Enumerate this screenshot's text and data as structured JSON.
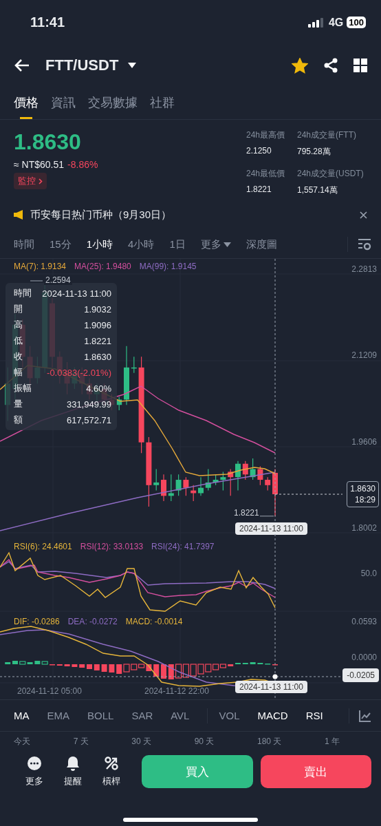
{
  "status_bar": {
    "time": "11:41",
    "network": "4G",
    "battery": "100"
  },
  "header": {
    "pair": "FTT/USDT",
    "favorite": true
  },
  "tabs": [
    {
      "label": "價格",
      "selected": true
    },
    {
      "label": "資訊",
      "selected": false
    },
    {
      "label": "交易數據",
      "selected": false
    },
    {
      "label": "社群",
      "selected": false
    }
  ],
  "ticker": {
    "price": "1.8630",
    "fiat": "≈ NT$60.51",
    "change": "-8.86%",
    "alert_button": "監控",
    "stats": [
      {
        "label": "24h最高價",
        "value": "2.1250"
      },
      {
        "label": "24h成交量(FTT)",
        "value": "795.28萬"
      },
      {
        "label": "24h最低價",
        "value": "1.8221"
      },
      {
        "label": "24h成交量(USDT)",
        "value": "1,557.14萬"
      }
    ]
  },
  "announcement": {
    "text": "币安每日热门币种（9月30日）"
  },
  "intervals": [
    {
      "label": "時間",
      "selected": false,
      "kind": "plain"
    },
    {
      "label": "15分",
      "selected": false,
      "kind": "plain"
    },
    {
      "label": "1小時",
      "selected": true,
      "kind": "plain"
    },
    {
      "label": "4小時",
      "selected": false,
      "kind": "plain"
    },
    {
      "label": "1日",
      "selected": false,
      "kind": "plain"
    },
    {
      "label": "更多",
      "selected": false,
      "kind": "dropdown"
    },
    {
      "label": "深度圖",
      "selected": false,
      "kind": "plain"
    }
  ],
  "chart": {
    "ma_legend": [
      {
        "label": "MA(7): 1.9134",
        "color": "#e6a93a"
      },
      {
        "label": "MA(25): 1.9480",
        "color": "#d44f9e"
      },
      {
        "label": "MA(99): 1.9145",
        "color": "#8e6cc4"
      }
    ],
    "price_axis": [
      "2.2813",
      "2.1209",
      "1.9606",
      "1.8002"
    ],
    "high_marker": "2.2594",
    "low_marker": "1.8221",
    "last_price": "1.8630",
    "countdown": "18:29",
    "crosshair_time": "2024-11-13 11:00",
    "tooltip": [
      {
        "label": "時間",
        "value": "2024-11-13 11:00",
        "kind": "plain"
      },
      {
        "label": "開",
        "value": "1.9032",
        "kind": "plain"
      },
      {
        "label": "高",
        "value": "1.9096",
        "kind": "plain"
      },
      {
        "label": "低",
        "value": "1.8221",
        "kind": "plain"
      },
      {
        "label": "收",
        "value": "1.8630",
        "kind": "plain"
      },
      {
        "label": "幅",
        "value": "-0.0383(-2.01%)",
        "kind": "negative"
      },
      {
        "label": "振幅",
        "value": "4.60%",
        "kind": "plain"
      },
      {
        "label": "量",
        "value": "331,949.99",
        "kind": "plain"
      },
      {
        "label": "額",
        "value": "617,572.71",
        "kind": "plain"
      }
    ]
  },
  "rsi": {
    "legend": [
      {
        "label": "RSI(6): 24.4601",
        "color": "#e6b53a"
      },
      {
        "label": "RSI(12): 33.0133",
        "color": "#d44f9e"
      },
      {
        "label": "RSI(24): 41.7397",
        "color": "#8e6cc4"
      }
    ],
    "axis": [
      "50.0"
    ]
  },
  "macd": {
    "legend": [
      {
        "label": "DIF: -0.0286",
        "color": "#e6b53a"
      },
      {
        "label": "DEA: -0.0272",
        "color": "#8e6cc4"
      },
      {
        "label": "MACD: -0.0014",
        "color": "#e6b53a"
      }
    ],
    "axis": [
      "0.0593",
      "0.0000"
    ],
    "crosshair_value": "-0.0205",
    "time_axis": [
      "2024-11-12 05:00",
      "2024-11-12 22:00"
    ],
    "crosshair_time": "2024-11-13 11:00"
  },
  "indicators": {
    "main": [
      {
        "label": "MA",
        "selected": true
      },
      {
        "label": "EMA",
        "selected": false
      },
      {
        "label": "BOLL",
        "selected": false
      },
      {
        "label": "SAR",
        "selected": false
      },
      {
        "label": "AVL",
        "selected": false
      }
    ],
    "sub": [
      {
        "label": "VOL",
        "selected": false
      },
      {
        "label": "MACD",
        "selected": true
      },
      {
        "label": "RSI",
        "selected": true
      }
    ]
  },
  "ranges": [
    "今天",
    "7 天",
    "30 天",
    "90 天",
    "180 天",
    "1 年"
  ],
  "actions": [
    {
      "label": "更多",
      "kind": "more"
    },
    {
      "label": "提醒",
      "kind": "bell"
    },
    {
      "label": "槓桿",
      "kind": "leverage"
    }
  ],
  "buy_button": "買入",
  "sell_button": "賣出"
}
